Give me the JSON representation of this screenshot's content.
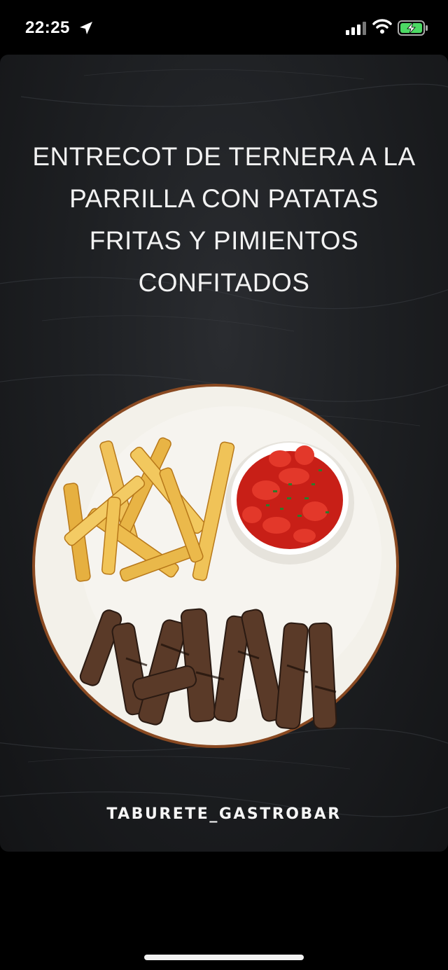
{
  "status_bar": {
    "time": "22:25",
    "icons": [
      "location-arrow-icon",
      "cellular-signal-icon",
      "wifi-icon",
      "battery-charging-icon"
    ],
    "battery_color": "#4cd964"
  },
  "story": {
    "title": "ENTRECOT DE TERNERA A LA PARRILLA CON PATATAS FRITAS Y PIMIENTOS CONFITADOS",
    "brand": "TABURETE_GASTROBAR",
    "background_color": "#1e2023"
  }
}
